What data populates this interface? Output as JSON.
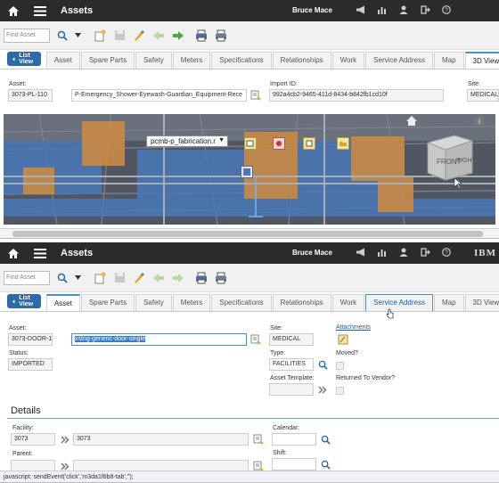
{
  "app": {
    "title": "Assets",
    "user": "Bruce Mace",
    "brand": "IBM"
  },
  "toolbar": {
    "find_placeholder": "Find Asset"
  },
  "list_view_label": "List View",
  "tabs_top": [
    "Asset",
    "Spare Parts",
    "Safety",
    "Meters",
    "Specifications",
    "Relationships",
    "Work",
    "Service Address",
    "Map",
    "3D View"
  ],
  "tabs_bottom": [
    "Asset",
    "Spare Parts",
    "Safety",
    "Meters",
    "Specifications",
    "Relationships",
    "Work",
    "Service Address",
    "Map",
    "3D View"
  ],
  "top": {
    "asset_label": "Asset:",
    "asset_value": "3073-PL-110",
    "description_value": "P-Emergency_Shower-Eyewash-Guardian_Equipment-Rece",
    "import_id_label": "Import ID:",
    "import_id_value": "992a4cb2-9465-411d-8434-b842fb1cd10f",
    "site_label": "Site:",
    "site_value": "MEDICAL",
    "model_dropdown": "pcmb-p_fabrication.r",
    "cube_front": "FRONT",
    "cube_right": "RIGHT"
  },
  "bottom": {
    "asset_label": "Asset:",
    "asset_value": "3073-DOOR-1",
    "description_value": "xstng-generic-door-single",
    "status_label": "Status:",
    "status_value": "IMPORTED",
    "site_label": "Site:",
    "site_value": "MEDICAL",
    "type_label": "Type:",
    "type_value": "FACILITIES",
    "asset_template_label": "Asset Template:",
    "attachments_label": "Attachments",
    "moved_label": "Moved?",
    "returned_label": "Returned To Vendor?",
    "details_title": "Details",
    "facility_label": "Facility:",
    "facility_value": "3073",
    "facility_desc": "3073",
    "calendar_label": "Calendar:",
    "parent_label": "Parent:",
    "shift_label": "Shift:",
    "js_status": "javascript: sendEvent('click','m3da1f8b8-tab','');"
  },
  "colors": {
    "topbar": "#2b2b2b",
    "accent": "#2f6aa8",
    "tab_active_border": "#4a90c2"
  }
}
